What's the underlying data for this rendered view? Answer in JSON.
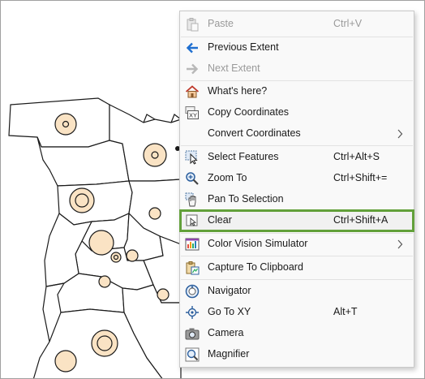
{
  "colors": {
    "highlight_border": "#62a03a",
    "accent_blue": "#1f6fd0",
    "map_fill": "#fae3c4"
  },
  "context_menu": {
    "items": [
      {
        "label": "Paste",
        "shortcut": "Ctrl+V",
        "icon": "paste-icon",
        "disabled": true
      },
      {
        "label": "Previous Extent",
        "shortcut": "",
        "icon": "back-arrow-icon",
        "disabled": false
      },
      {
        "label": "Next Extent",
        "shortcut": "",
        "icon": "forward-arrow-icon",
        "disabled": true
      },
      {
        "label": "What's here?",
        "shortcut": "",
        "icon": "house-icon",
        "disabled": false
      },
      {
        "label": "Copy Coordinates",
        "shortcut": "",
        "icon": "xy-coordinates-icon",
        "disabled": false
      },
      {
        "label": "Convert Coordinates",
        "shortcut": "",
        "icon": "",
        "submenu": true,
        "disabled": false
      },
      {
        "label": "Select Features",
        "shortcut": "Ctrl+Alt+S",
        "icon": "select-cursor-icon",
        "disabled": false
      },
      {
        "label": "Zoom To",
        "shortcut": "Ctrl+Shift+=",
        "icon": "zoom-to-icon",
        "disabled": false
      },
      {
        "label": "Pan To Selection",
        "shortcut": "",
        "icon": "hand-icon",
        "disabled": false
      },
      {
        "label": "Clear",
        "shortcut": "Ctrl+Shift+A",
        "icon": "clear-selection-icon",
        "disabled": false,
        "highlighted": true
      },
      {
        "label": "Color Vision Simulator",
        "shortcut": "",
        "icon": "color-vision-icon",
        "submenu": true,
        "disabled": false
      },
      {
        "label": "Capture To Clipboard",
        "shortcut": "",
        "icon": "clipboard-capture-icon",
        "disabled": false
      },
      {
        "label": "Navigator",
        "shortcut": "",
        "icon": "navigator-icon",
        "disabled": false
      },
      {
        "label": "Go To XY",
        "shortcut": "Alt+T",
        "icon": "crosshair-icon",
        "disabled": false
      },
      {
        "label": "Camera",
        "shortcut": "",
        "icon": "camera-icon",
        "disabled": false
      },
      {
        "label": "Magnifier",
        "shortcut": "",
        "icon": "magnifier-icon",
        "disabled": false
      }
    ]
  }
}
